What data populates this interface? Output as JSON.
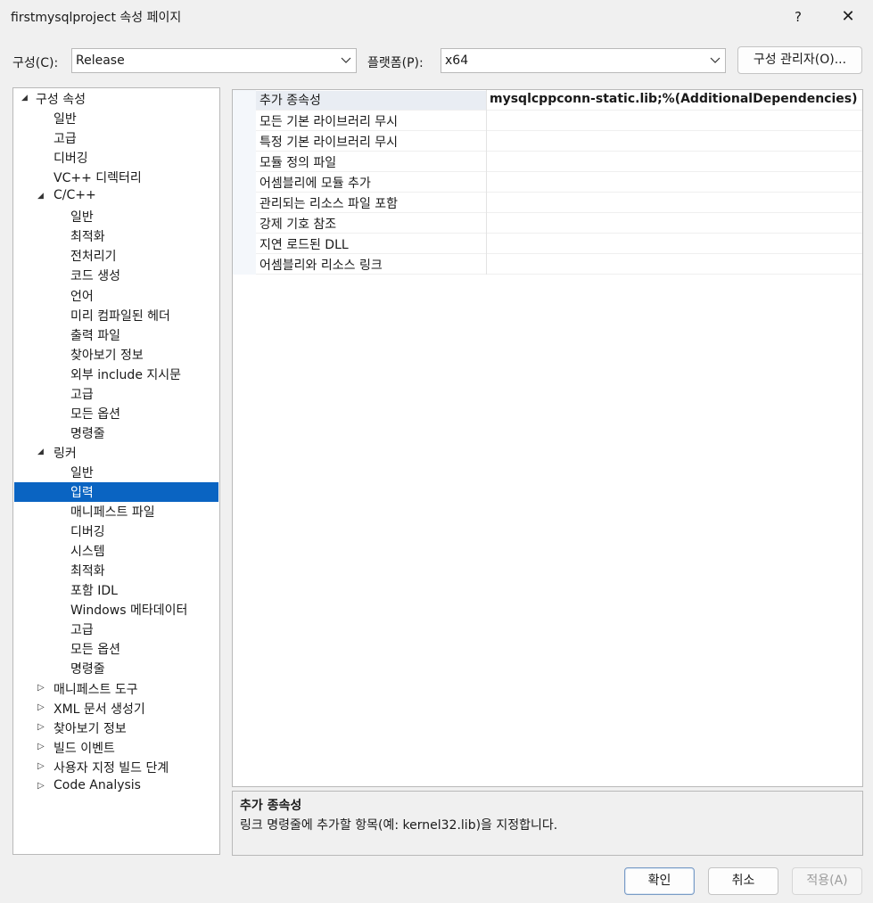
{
  "window": {
    "title": "firstmysqlproject 속성 페이지",
    "help_label": "?",
    "close_label": "✕"
  },
  "toolbar": {
    "config_label": "구성(C):",
    "config_value": "Release",
    "platform_label": "플랫폼(P):",
    "platform_value": "x64",
    "config_manager_label": "구성 관리자(O)..."
  },
  "tree": {
    "items": [
      {
        "label": "구성 속성",
        "expander": "▲"
      },
      {
        "label": "일반"
      },
      {
        "label": "고급"
      },
      {
        "label": "디버깅"
      },
      {
        "label": "VC++ 디렉터리"
      },
      {
        "label": "C/C++",
        "expander": "▲"
      },
      {
        "label": "일반"
      },
      {
        "label": "최적화"
      },
      {
        "label": "전처리기"
      },
      {
        "label": "코드 생성"
      },
      {
        "label": "언어"
      },
      {
        "label": "미리 컴파일된 헤더"
      },
      {
        "label": "출력 파일"
      },
      {
        "label": "찾아보기 정보"
      },
      {
        "label": "외부 include 지시문"
      },
      {
        "label": "고급"
      },
      {
        "label": "모든 옵션"
      },
      {
        "label": "명령줄"
      },
      {
        "label": "링커",
        "expander": "▲"
      },
      {
        "label": "일반"
      },
      {
        "label": "입력",
        "selected": true
      },
      {
        "label": "매니페스트 파일"
      },
      {
        "label": "디버깅"
      },
      {
        "label": "시스템"
      },
      {
        "label": "최적화"
      },
      {
        "label": "포함 IDL"
      },
      {
        "label": "Windows 메타데이터"
      },
      {
        "label": "고급"
      },
      {
        "label": "모든 옵션"
      },
      {
        "label": "명령줄"
      },
      {
        "label": "매니페스트 도구",
        "expander": "▷"
      },
      {
        "label": "XML 문서 생성기",
        "expander": "▷"
      },
      {
        "label": "찾아보기 정보",
        "expander": "▷"
      },
      {
        "label": "빌드 이벤트",
        "expander": "▷"
      },
      {
        "label": "사용자 지정 빌드 단계",
        "expander": "▷"
      },
      {
        "label": "Code Analysis",
        "expander": "▷"
      }
    ]
  },
  "properties": [
    {
      "name": "추가 종속성",
      "value": "mysqlcppconn-static.lib;%(AdditionalDependencies)",
      "selected": true
    },
    {
      "name": "모든 기본 라이브러리 무시",
      "value": ""
    },
    {
      "name": "특정 기본 라이브러리 무시",
      "value": ""
    },
    {
      "name": "모듈 정의 파일",
      "value": ""
    },
    {
      "name": "어셈블리에 모듈 추가",
      "value": ""
    },
    {
      "name": "관리되는 리소스 파일 포함",
      "value": ""
    },
    {
      "name": "강제 기호 참조",
      "value": ""
    },
    {
      "name": "지연 로드된 DLL",
      "value": ""
    },
    {
      "name": "어셈블리와 리소스 링크",
      "value": ""
    }
  ],
  "description": {
    "title": "추가 종속성",
    "text": "링크 명령줄에 추가할 항목(예: kernel32.lib)을 지정합니다."
  },
  "footer": {
    "ok_label": "확인",
    "cancel_label": "취소",
    "apply_label": "적용(A)"
  },
  "colors": {
    "selection": "#0a64c2",
    "background": "#f0f0f0"
  }
}
